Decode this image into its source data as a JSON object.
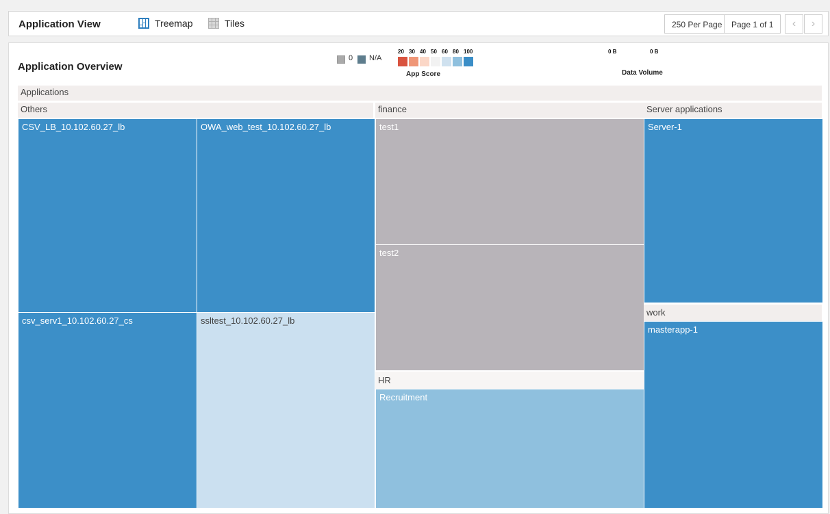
{
  "toolbar": {
    "title": "Application View",
    "views": [
      {
        "label": "Treemap",
        "icon": "treemap-icon",
        "active": true
      },
      {
        "label": "Tiles",
        "icon": "tiles-icon",
        "active": false
      }
    ],
    "per_page": "250 Per Page",
    "page_info": "Page 1 of 1",
    "prev_icon": "chevron-left-icon",
    "next_icon": "chevron-right-icon"
  },
  "overview": {
    "title": "Application Overview",
    "legend_zero": "0",
    "legend_na": "N/A",
    "score_ticks": [
      "20",
      "30",
      "40",
      "50",
      "60",
      "80",
      "100"
    ],
    "score_colors": [
      "#d9533f",
      "#ef9677",
      "#fbd7c7",
      "#f2f2f2",
      "#cfe1ef",
      "#8fc0de",
      "#3b8ec7"
    ],
    "score_caption": "App Score",
    "volume_low": "0 B",
    "volume_high": "0 B",
    "volume_caption": "Data Volume"
  },
  "treemap": {
    "root": "Applications",
    "groups": {
      "others": "Others",
      "finance": "finance",
      "server": "Server applications",
      "work": "work",
      "hr": "HR"
    },
    "apps": {
      "csv_lb": "CSV_LB_10.102.60.27_lb",
      "owa": "OWA_web_test_10.102.60.27_lb",
      "csv_serv1": "csv_serv1_10.102.60.27_cs",
      "ssltest": "ssltest_10.102.60.27_lb",
      "test1": "test1",
      "test2": "test2",
      "recruitment": "Recruitment",
      "server1": "Server-1",
      "masterapp": "masterapp-1"
    },
    "colors": {
      "blue": "#3c8fc8",
      "grey": "#b8b4b9",
      "pale_blue": "#cbe0f0",
      "mid_blue": "#8fc0de",
      "zero_grey": "#aaaaaa",
      "na_slate": "#5e7d8d"
    }
  }
}
